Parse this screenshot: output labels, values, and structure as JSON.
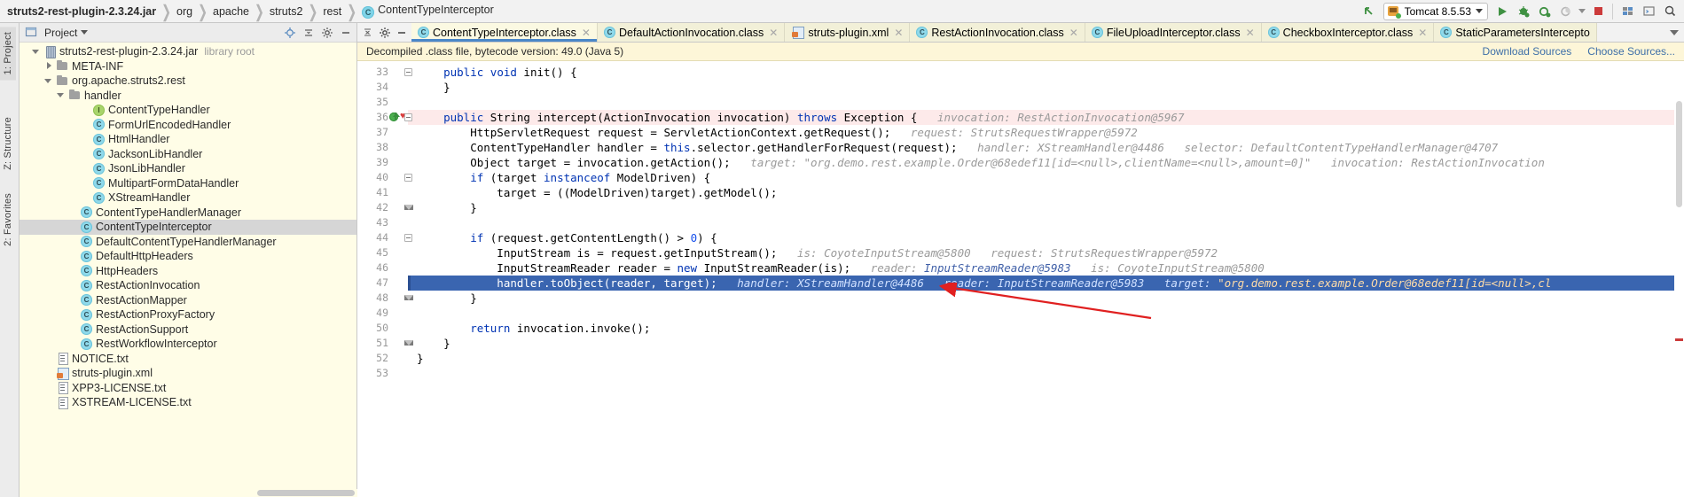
{
  "window": {
    "breadcrumb": [
      {
        "label": "struts2-rest-plugin-2.3.24.jar",
        "bold": true,
        "icon": null
      },
      {
        "label": "org",
        "bold": false,
        "icon": null
      },
      {
        "label": "apache",
        "bold": false,
        "icon": null
      },
      {
        "label": "struts2",
        "bold": false,
        "icon": null
      },
      {
        "label": "rest",
        "bold": false,
        "icon": null
      },
      {
        "label": "ContentTypeInterceptor",
        "bold": false,
        "icon": "class-badge"
      }
    ],
    "toolbar_right": {
      "back_icon": "arrow-up-left-icon",
      "run_config": "Tomcat 8.5.53",
      "run_config_icon": "tomcat-icon",
      "dropdown_icon": "chevron-down-icon",
      "run_icon": "run-icon",
      "debug_icon": "debug-icon",
      "attach_icon": "attach-debugger-icon",
      "coverage_icon": "run-coverage-icon",
      "coverage_dropdown_icon": "chevron-down-icon",
      "stop_icon": "stop-icon",
      "build_icon": "build-project-icon",
      "terminal_icon": "open-terminal-icon",
      "search_icon": "search-everywhere-icon"
    }
  },
  "left_strip": {
    "tabs": [
      {
        "label": "1: Project",
        "selected": true
      },
      {
        "label": "Z: Structure",
        "selected": false
      },
      {
        "label": "2: Favorites",
        "selected": false
      }
    ]
  },
  "project_panel": {
    "header": {
      "title": "Project",
      "dropdown_icon": "chevron-down-icon",
      "buttons": [
        {
          "name": "locate-icon"
        },
        {
          "name": "expand-collapse-icon"
        },
        {
          "name": "settings-gear-icon"
        },
        {
          "name": "hide-panel-icon"
        }
      ]
    },
    "tree": [
      {
        "indent": 1,
        "twisty": "open",
        "icon": "jar",
        "label": "struts2-rest-plugin-2.3.24.jar",
        "suffix": "library root",
        "selected": false
      },
      {
        "indent": 2,
        "twisty": "closed",
        "icon": "folder",
        "label": "META-INF",
        "suffix": "",
        "selected": false
      },
      {
        "indent": 2,
        "twisty": "open",
        "icon": "folder",
        "label": "org.apache.struts2.rest",
        "suffix": "",
        "selected": false
      },
      {
        "indent": 3,
        "twisty": "open",
        "icon": "folder",
        "label": "handler",
        "suffix": "",
        "selected": false
      },
      {
        "indent": 5,
        "twisty": "none",
        "icon": "iface",
        "label": "ContentTypeHandler",
        "suffix": "",
        "selected": false
      },
      {
        "indent": 5,
        "twisty": "none",
        "icon": "class",
        "label": "FormUrlEncodedHandler",
        "suffix": "",
        "selected": false
      },
      {
        "indent": 5,
        "twisty": "none",
        "icon": "class",
        "label": "HtmlHandler",
        "suffix": "",
        "selected": false
      },
      {
        "indent": 5,
        "twisty": "none",
        "icon": "class",
        "label": "JacksonLibHandler",
        "suffix": "",
        "selected": false
      },
      {
        "indent": 5,
        "twisty": "none",
        "icon": "class",
        "label": "JsonLibHandler",
        "suffix": "",
        "selected": false
      },
      {
        "indent": 5,
        "twisty": "none",
        "icon": "class",
        "label": "MultipartFormDataHandler",
        "suffix": "",
        "selected": false
      },
      {
        "indent": 5,
        "twisty": "none",
        "icon": "class",
        "label": "XStreamHandler",
        "suffix": "",
        "selected": false
      },
      {
        "indent": 4,
        "twisty": "none",
        "icon": "class",
        "label": "ContentTypeHandlerManager",
        "suffix": "",
        "selected": false
      },
      {
        "indent": 4,
        "twisty": "none",
        "icon": "class",
        "label": "ContentTypeInterceptor",
        "suffix": "",
        "selected": true
      },
      {
        "indent": 4,
        "twisty": "none",
        "icon": "class",
        "label": "DefaultContentTypeHandlerManager",
        "suffix": "",
        "selected": false
      },
      {
        "indent": 4,
        "twisty": "none",
        "icon": "class",
        "label": "DefaultHttpHeaders",
        "suffix": "",
        "selected": false
      },
      {
        "indent": 4,
        "twisty": "none",
        "icon": "class",
        "label": "HttpHeaders",
        "suffix": "",
        "selected": false
      },
      {
        "indent": 4,
        "twisty": "none",
        "icon": "class",
        "label": "RestActionInvocation",
        "suffix": "",
        "selected": false
      },
      {
        "indent": 4,
        "twisty": "none",
        "icon": "class",
        "label": "RestActionMapper",
        "suffix": "",
        "selected": false
      },
      {
        "indent": 4,
        "twisty": "none",
        "icon": "class",
        "label": "RestActionProxyFactory",
        "suffix": "",
        "selected": false
      },
      {
        "indent": 4,
        "twisty": "none",
        "icon": "class",
        "label": "RestActionSupport",
        "suffix": "",
        "selected": false
      },
      {
        "indent": 4,
        "twisty": "none",
        "icon": "class",
        "label": "RestWorkflowInterceptor",
        "suffix": "",
        "selected": false
      },
      {
        "indent": 2,
        "twisty": "none",
        "icon": "txt",
        "label": "NOTICE.txt",
        "suffix": "",
        "selected": false
      },
      {
        "indent": 2,
        "twisty": "none",
        "icon": "xml",
        "label": "struts-plugin.xml",
        "suffix": "",
        "selected": false
      },
      {
        "indent": 2,
        "twisty": "none",
        "icon": "txt",
        "label": "XPP3-LICENSE.txt",
        "suffix": "",
        "selected": false
      },
      {
        "indent": 2,
        "twisty": "none",
        "icon": "txt",
        "label": "XSTREAM-LICENSE.txt",
        "suffix": "",
        "selected": false
      }
    ]
  },
  "editor": {
    "tab_tools": [
      {
        "name": "expand-collapse-all-icon"
      },
      {
        "name": "settings-gear-icon"
      },
      {
        "name": "hide-editor-icon"
      }
    ],
    "tabs": [
      {
        "label": "ContentTypeInterceptor.class",
        "icon": "class-badge",
        "active": true,
        "closable": true
      },
      {
        "label": "DefaultActionInvocation.class",
        "icon": "class-badge",
        "active": false,
        "closable": true
      },
      {
        "label": "struts-plugin.xml",
        "icon": "xml-file",
        "active": false,
        "closable": true
      },
      {
        "label": "RestActionInvocation.class",
        "icon": "class-badge",
        "active": false,
        "closable": true
      },
      {
        "label": "FileUploadInterceptor.class",
        "icon": "class-badge",
        "active": false,
        "closable": true
      },
      {
        "label": "CheckboxInterceptor.class",
        "icon": "class-badge",
        "active": false,
        "closable": true
      },
      {
        "label": "StaticParametersIntercepto",
        "icon": "class-badge",
        "active": false,
        "closable": false
      }
    ],
    "tabs_overflow_icon": "chevron-down-icon",
    "notification": {
      "message": "Decompiled .class file, bytecode version: 49.0 (Java 5)",
      "links": [
        {
          "label": "Download Sources"
        },
        {
          "label": "Choose Sources..."
        }
      ]
    },
    "code": {
      "first_line": 33,
      "lines": [
        {
          "n": 33,
          "fold": "collapse",
          "breakpoint": false,
          "highlight": "none",
          "segments": [
            {
              "t": "    ",
              "c": "plain"
            },
            {
              "t": "public",
              "c": "kw"
            },
            {
              "t": " ",
              "c": "plain"
            },
            {
              "t": "void",
              "c": "kw"
            },
            {
              "t": " init() {",
              "c": "plain"
            }
          ]
        },
        {
          "n": 34,
          "fold": "none",
          "breakpoint": false,
          "highlight": "none",
          "segments": [
            {
              "t": "    }",
              "c": "plain"
            }
          ]
        },
        {
          "n": 35,
          "fold": "none",
          "breakpoint": false,
          "highlight": "none",
          "segments": [
            {
              "t": "",
              "c": "plain"
            }
          ]
        },
        {
          "n": 36,
          "fold": "collapse",
          "breakpoint": true,
          "highlight": "pink",
          "segments": [
            {
              "t": "    ",
              "c": "plain"
            },
            {
              "t": "public",
              "c": "kw"
            },
            {
              "t": " String intercept(ActionInvocation invocation) ",
              "c": "plain"
            },
            {
              "t": "throws",
              "c": "kw"
            },
            {
              "t": " Exception {",
              "c": "plain"
            },
            {
              "t": "   invocation: RestActionInvocation@5967",
              "c": "hint"
            }
          ]
        },
        {
          "n": 37,
          "fold": "none",
          "breakpoint": false,
          "highlight": "none",
          "segments": [
            {
              "t": "        HttpServletRequest request = ServletActionContext.getRequest();",
              "c": "plain"
            },
            {
              "t": "   request: StrutsRequestWrapper@5972",
              "c": "hint"
            }
          ]
        },
        {
          "n": 38,
          "fold": "none",
          "breakpoint": false,
          "highlight": "none",
          "segments": [
            {
              "t": "        ContentTypeHandler handler = ",
              "c": "plain"
            },
            {
              "t": "this",
              "c": "kw"
            },
            {
              "t": ".selector.getHandlerForRequest(request);",
              "c": "plain"
            },
            {
              "t": "   handler: XStreamHandler@4486   selector: DefaultContentTypeHandlerManager@4707",
              "c": "hint"
            }
          ]
        },
        {
          "n": 39,
          "fold": "none",
          "breakpoint": false,
          "highlight": "none",
          "segments": [
            {
              "t": "        Object target = invocation.getAction();",
              "c": "plain"
            },
            {
              "t": "   target: \"org.demo.rest.example.Order@68edef11[id=<null>,clientName=<null>,amount=0]\"   invocation: RestActionInvocation",
              "c": "hint"
            }
          ]
        },
        {
          "n": 40,
          "fold": "collapse",
          "breakpoint": false,
          "highlight": "none",
          "segments": [
            {
              "t": "        ",
              "c": "plain"
            },
            {
              "t": "if",
              "c": "kw"
            },
            {
              "t": " (target ",
              "c": "plain"
            },
            {
              "t": "instanceof",
              "c": "kw"
            },
            {
              "t": " ModelDriven) {",
              "c": "plain"
            }
          ]
        },
        {
          "n": 41,
          "fold": "none",
          "breakpoint": false,
          "highlight": "none",
          "segments": [
            {
              "t": "            target = ((ModelDriven)target).getModel();",
              "c": "plain"
            }
          ]
        },
        {
          "n": 42,
          "fold": "collapse-end",
          "breakpoint": false,
          "highlight": "none",
          "segments": [
            {
              "t": "        }",
              "c": "plain"
            }
          ]
        },
        {
          "n": 43,
          "fold": "none",
          "breakpoint": false,
          "highlight": "none",
          "segments": [
            {
              "t": "",
              "c": "plain"
            }
          ]
        },
        {
          "n": 44,
          "fold": "collapse",
          "breakpoint": false,
          "highlight": "none",
          "segments": [
            {
              "t": "        ",
              "c": "plain"
            },
            {
              "t": "if",
              "c": "kw"
            },
            {
              "t": " (request.getContentLength() > ",
              "c": "plain"
            },
            {
              "t": "0",
              "c": "num"
            },
            {
              "t": ") {",
              "c": "plain"
            }
          ]
        },
        {
          "n": 45,
          "fold": "none",
          "breakpoint": false,
          "highlight": "none",
          "segments": [
            {
              "t": "            InputStream is = request.getInputStream();",
              "c": "plain"
            },
            {
              "t": "   is: CoyoteInputStream@5800   request: StrutsRequestWrapper@5972",
              "c": "hint"
            }
          ]
        },
        {
          "n": 46,
          "fold": "none",
          "breakpoint": false,
          "highlight": "none",
          "segments": [
            {
              "t": "            InputStreamReader reader = ",
              "c": "plain"
            },
            {
              "t": "new",
              "c": "kw"
            },
            {
              "t": " InputStreamReader(is);",
              "c": "plain"
            },
            {
              "t": "   reader: ",
              "c": "hint"
            },
            {
              "t": "InputStreamReader@5983",
              "c": "hintb"
            },
            {
              "t": "   is: CoyoteInputStream@5800",
              "c": "hint"
            }
          ]
        },
        {
          "n": 47,
          "fold": "none",
          "breakpoint": false,
          "highlight": "blue",
          "segments": [
            {
              "t": "            handler.toObject(reader, target);",
              "c": "txt-on-blue"
            },
            {
              "t": "   handler: XStreamHandler@4486   reader: ",
              "c": "hint-on-blue"
            },
            {
              "t": "InputStreamReader@5983",
              "c": "hint-on-blue-b"
            },
            {
              "t": "   target: ",
              "c": "hint-on-blue"
            },
            {
              "t": "\"org.demo.rest.example.Order@68edef11[id=<null>,cl",
              "c": "str-on-blue"
            }
          ]
        },
        {
          "n": 48,
          "fold": "collapse-end",
          "breakpoint": false,
          "highlight": "none",
          "segments": [
            {
              "t": "        }",
              "c": "plain"
            }
          ]
        },
        {
          "n": 49,
          "fold": "none",
          "breakpoint": false,
          "highlight": "none",
          "segments": [
            {
              "t": "",
              "c": "plain"
            }
          ]
        },
        {
          "n": 50,
          "fold": "none",
          "breakpoint": false,
          "highlight": "none",
          "segments": [
            {
              "t": "        ",
              "c": "plain"
            },
            {
              "t": "return",
              "c": "kw"
            },
            {
              "t": " invocation.invoke();",
              "c": "plain"
            }
          ]
        },
        {
          "n": 51,
          "fold": "collapse-end",
          "breakpoint": false,
          "highlight": "none",
          "segments": [
            {
              "t": "    }",
              "c": "plain"
            }
          ]
        },
        {
          "n": 52,
          "fold": "none",
          "breakpoint": false,
          "highlight": "none",
          "segments": [
            {
              "t": "}",
              "c": "plain"
            }
          ]
        },
        {
          "n": 53,
          "fold": "none",
          "breakpoint": false,
          "highlight": "none",
          "segments": [
            {
              "t": "",
              "c": "plain"
            }
          ]
        }
      ]
    },
    "annotation": {
      "type": "red-arrow",
      "points_to_line": 47
    }
  },
  "colors": {
    "accent_blue": "#3a65b0",
    "tab_active_underline": "#4a87c8",
    "panel_bg": "#fffde7",
    "notification_bg": "#fdf6d8",
    "keyword": "#0033b3",
    "string": "#067d17",
    "number": "#1750eb",
    "hint_gray": "#9a9a9a",
    "breakpoint_green": "#4caf50",
    "stop_red": "#cc3b3b",
    "annotation_red": "#e02020"
  }
}
